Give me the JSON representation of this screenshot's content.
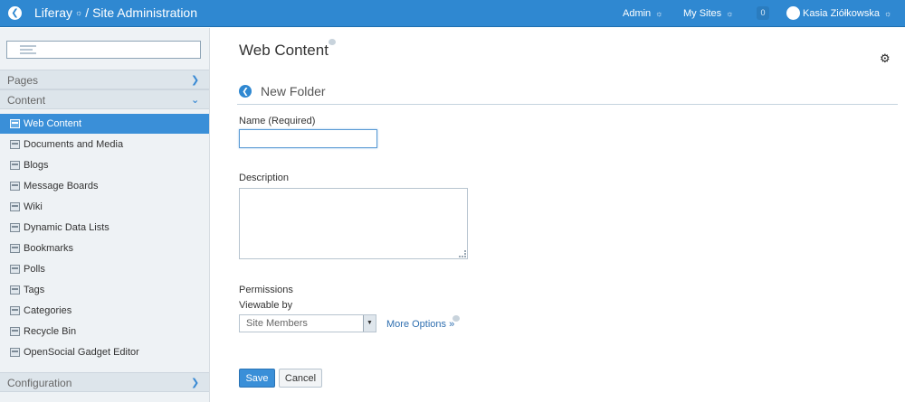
{
  "topbar": {
    "title_product": "Liferay",
    "title_separator": "/",
    "title_section": "Site Administration",
    "admin_label": "Admin",
    "my_sites_label": "My Sites",
    "notification_count": "0",
    "user_name": "Kasia Ziółkowska"
  },
  "sidebar": {
    "sections": {
      "pages": "Pages",
      "content": "Content",
      "configuration": "Configuration"
    },
    "items": [
      {
        "label": "Web Content",
        "icon": "web-content-icon",
        "active": true
      },
      {
        "label": "Documents and Media",
        "icon": "documents-icon"
      },
      {
        "label": "Blogs",
        "icon": "blogs-icon"
      },
      {
        "label": "Message Boards",
        "icon": "message-boards-icon"
      },
      {
        "label": "Wiki",
        "icon": "wiki-icon"
      },
      {
        "label": "Dynamic Data Lists",
        "icon": "data-lists-icon"
      },
      {
        "label": "Bookmarks",
        "icon": "bookmarks-icon"
      },
      {
        "label": "Polls",
        "icon": "polls-icon"
      },
      {
        "label": "Tags",
        "icon": "tags-icon"
      },
      {
        "label": "Categories",
        "icon": "categories-icon"
      },
      {
        "label": "Recycle Bin",
        "icon": "recycle-bin-icon"
      },
      {
        "label": "OpenSocial Gadget Editor",
        "icon": "gadget-editor-icon"
      }
    ]
  },
  "main": {
    "title": "Web Content",
    "form_title": "New Folder",
    "name_label": "Name (Required)",
    "name_value": "",
    "description_label": "Description",
    "description_value": "",
    "permissions_label": "Permissions",
    "viewable_by_label": "Viewable by",
    "viewable_by_value": "Site Members",
    "more_options_label": "More Options »",
    "save_label": "Save",
    "cancel_label": "Cancel"
  },
  "colors": {
    "topbar": "#2f88d1",
    "active_item": "#3a8fd8",
    "sidebar_bg": "#eef2f5",
    "link": "#2f6fb0"
  }
}
